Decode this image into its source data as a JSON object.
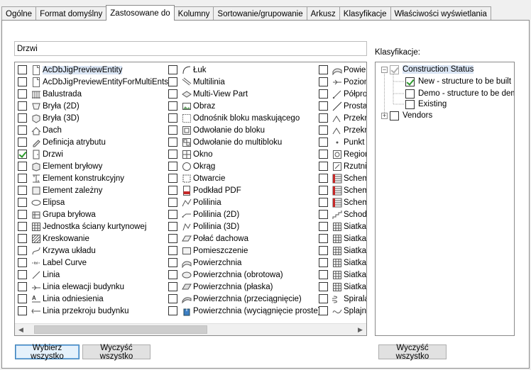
{
  "tabs": [
    "Ogólne",
    "Format domyślny",
    "Zastosowane do",
    "Kolumny",
    "Sortowanie/grupowanie",
    "Arkusz",
    "Klasyfikacje",
    "Właściwości wyświetlania"
  ],
  "active_tab": "Zastosowane do",
  "name_input": {
    "value": "Drzwi"
  },
  "object_list": {
    "columns": [
      [
        {
          "label": "AcDbJigPreviewEntity",
          "checked": false,
          "icon": "document-icon",
          "selected": true
        },
        {
          "label": "AcDbJigPreviewEntityForMultiEnts",
          "checked": false,
          "icon": "document-icon"
        },
        {
          "label": "Balustrada",
          "checked": false,
          "icon": "railing-icon"
        },
        {
          "label": "Bryła (2D)",
          "checked": false,
          "icon": "mass-2d-icon"
        },
        {
          "label": "Bryła (3D)",
          "checked": false,
          "icon": "mass-3d-icon"
        },
        {
          "label": "Dach",
          "checked": false,
          "icon": "roof-icon"
        },
        {
          "label": "Definicja atrybutu",
          "checked": false,
          "icon": "attribute-icon"
        },
        {
          "label": "Drzwi",
          "checked": true,
          "icon": "door-icon"
        },
        {
          "label": "Element bryłowy",
          "checked": false,
          "icon": "mass-element-icon"
        },
        {
          "label": "Element konstrukcyjny",
          "checked": false,
          "icon": "structural-icon"
        },
        {
          "label": "Element zależny",
          "checked": false,
          "icon": "dependent-icon"
        },
        {
          "label": "Elipsa",
          "checked": false,
          "icon": "ellipse-icon"
        },
        {
          "label": "Grupa bryłowa",
          "checked": false,
          "icon": "mass-group-icon"
        },
        {
          "label": "Jednostka ściany kurtynowej",
          "checked": false,
          "icon": "curtain-wall-icon"
        },
        {
          "label": "Kreskowanie",
          "checked": false,
          "icon": "hatch-icon"
        },
        {
          "label": "Krzywa układu",
          "checked": false,
          "icon": "layout-curve-icon"
        },
        {
          "label": "Label Curve",
          "checked": false,
          "icon": "label-curve-icon"
        },
        {
          "label": "Linia",
          "checked": false,
          "icon": "line-icon"
        },
        {
          "label": "Linia elewacji budynku",
          "checked": false,
          "icon": "elevation-line-icon"
        },
        {
          "label": "Linia odniesienia",
          "checked": false,
          "icon": "leader-icon"
        },
        {
          "label": "Linia przekroju budynku",
          "checked": false,
          "icon": "section-line-icon"
        }
      ],
      [
        {
          "label": "Łuk",
          "checked": false,
          "icon": "arc-icon"
        },
        {
          "label": "Multilinia",
          "checked": false,
          "icon": "multiline-icon"
        },
        {
          "label": "Multi-View Part",
          "checked": false,
          "icon": "mvpart-icon"
        },
        {
          "label": "Obraz",
          "checked": false,
          "icon": "image-icon"
        },
        {
          "label": "Odnośnik bloku maskującego",
          "checked": false,
          "icon": "mask-block-icon"
        },
        {
          "label": "Odwołanie do bloku",
          "checked": false,
          "icon": "block-ref-icon"
        },
        {
          "label": "Odwołanie do multibloku",
          "checked": false,
          "icon": "multiblock-ref-icon"
        },
        {
          "label": "Okno",
          "checked": false,
          "icon": "window-icon"
        },
        {
          "label": "Okrąg",
          "checked": false,
          "icon": "circle-icon"
        },
        {
          "label": "Otwarcie",
          "checked": false,
          "icon": "opening-icon"
        },
        {
          "label": "Podkład PDF",
          "checked": false,
          "icon": "pdf-icon"
        },
        {
          "label": "Polilinia",
          "checked": false,
          "icon": "polyline-icon"
        },
        {
          "label": "Polilinia (2D)",
          "checked": false,
          "icon": "polyline-2d-icon"
        },
        {
          "label": "Polilinia (3D)",
          "checked": false,
          "icon": "polyline-3d-icon"
        },
        {
          "label": "Połać dachowa",
          "checked": false,
          "icon": "roof-slab-icon"
        },
        {
          "label": "Pomieszczenie",
          "checked": false,
          "icon": "space-icon"
        },
        {
          "label": "Powierzchnia",
          "checked": false,
          "icon": "surface-icon"
        },
        {
          "label": "Powierzchnia (obrotowa)",
          "checked": false,
          "icon": "revolved-surface-icon"
        },
        {
          "label": "Powierzchnia (płaska)",
          "checked": false,
          "icon": "planar-surface-icon"
        },
        {
          "label": "Powierzchnia (przeciągnięcie)",
          "checked": false,
          "icon": "swept-surface-icon"
        },
        {
          "label": "Powierzchnia (wyciągnięcie proste)",
          "checked": false,
          "icon": "extruded-surface-icon"
        }
      ],
      [
        {
          "label": "Powier",
          "checked": false,
          "icon": "surface-icon"
        },
        {
          "label": "Poziom",
          "checked": false,
          "icon": "level-icon"
        },
        {
          "label": "Półpro",
          "checked": false,
          "icon": "ray-icon"
        },
        {
          "label": "Prosta",
          "checked": false,
          "icon": "xline-icon"
        },
        {
          "label": "Przekro",
          "checked": false,
          "icon": "section-icon"
        },
        {
          "label": "Przekro",
          "checked": false,
          "icon": "section-icon"
        },
        {
          "label": "Punkt",
          "checked": false,
          "icon": "point-icon"
        },
        {
          "label": "Region",
          "checked": false,
          "icon": "region-icon"
        },
        {
          "label": "Rzutni",
          "checked": false,
          "icon": "viewport-icon"
        },
        {
          "label": "Schem",
          "checked": false,
          "icon": "schedule-icon"
        },
        {
          "label": "Schem",
          "checked": false,
          "icon": "schedule-icon"
        },
        {
          "label": "Schem",
          "checked": false,
          "icon": "schedule-icon"
        },
        {
          "label": "Schody",
          "checked": false,
          "icon": "stair-icon"
        },
        {
          "label": "Siatka",
          "checked": false,
          "icon": "grid-icon"
        },
        {
          "label": "Siatka",
          "checked": false,
          "icon": "grid-icon"
        },
        {
          "label": "Siatka",
          "checked": false,
          "icon": "grid-icon"
        },
        {
          "label": "Siatka",
          "checked": false,
          "icon": "grid-icon"
        },
        {
          "label": "Siatka",
          "checked": false,
          "icon": "grid-icon"
        },
        {
          "label": "Siatka",
          "checked": false,
          "icon": "grid-icon"
        },
        {
          "label": "Spirala",
          "checked": false,
          "icon": "helix-icon"
        },
        {
          "label": "Splajn",
          "checked": false,
          "icon": "spline-icon"
        }
      ]
    ]
  },
  "classifications": {
    "label": "Klasyfikacje:",
    "tree": [
      {
        "label": "Construction Status",
        "expander": "−",
        "checked": true,
        "grey": true,
        "selected": true,
        "level": 0
      },
      {
        "label": "New - structure to be built",
        "checked": true,
        "level": 1
      },
      {
        "label": "Demo - structure to be demolis",
        "checked": false,
        "level": 1
      },
      {
        "label": "Existing",
        "checked": false,
        "level": 1
      },
      {
        "label": "Vendors",
        "expander": "+",
        "checked": false,
        "level": 0
      }
    ]
  },
  "buttons": {
    "select_all": "Wybierz wszystko",
    "clear_all": "Wyczyść wszystko",
    "clear_all_classifications": "Wyczyść wszystko"
  }
}
